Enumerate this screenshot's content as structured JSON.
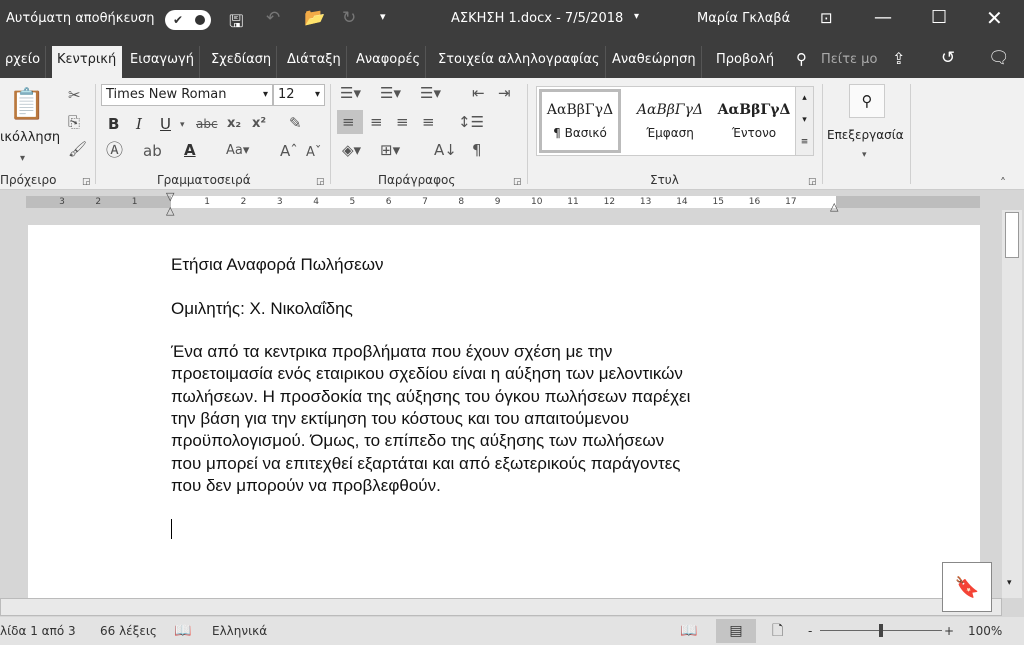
{
  "titlebar": {
    "autosave_label": "Αυτόματη αποθήκευση",
    "doc_title": "ΑΣΚΗΣΗ 1.docx  -  7/5/2018",
    "user": "Μαρία Γκλαβά"
  },
  "tabs": [
    {
      "label": "ρχείο"
    },
    {
      "label": "Κεντρική",
      "active": true
    },
    {
      "label": "Εισαγωγή"
    },
    {
      "label": "Σχεδίαση"
    },
    {
      "label": "Διάταξη"
    },
    {
      "label": "Αναφορές"
    },
    {
      "label": "Στοιχεία αλληλογραφίας"
    },
    {
      "label": "Αναθεώρηση"
    },
    {
      "label": "Προβολή"
    }
  ],
  "tell_me": "Πείτε μο",
  "ribbon": {
    "paste_label": "ικόλληση",
    "font_name": "Times New Roman",
    "font_size": "12",
    "groups": {
      "clipboard": "Πρόχειρο",
      "font": "Γραμματοσειρά",
      "paragraph": "Παράγραφος",
      "styles": "Στυλ"
    },
    "styles": [
      {
        "sample": "ΑαΒβΓγΔ",
        "label": "¶ Βασικό"
      },
      {
        "sample": "ΑαΒβΓγΔ",
        "label": "Έμφαση"
      },
      {
        "sample": "ΑαΒβΓγΔ",
        "label": "Έντονο"
      }
    ],
    "editing_label": "Επεξεργασία"
  },
  "ruler": {
    "left_numbers": [
      "3",
      "2",
      "1"
    ],
    "right_numbers": [
      "1",
      "2",
      "3",
      "4",
      "5",
      "6",
      "7",
      "8",
      "9",
      "10",
      "11",
      "12",
      "13",
      "14",
      "15",
      "16",
      "17"
    ]
  },
  "document": {
    "title": "Ετήσια Αναφορά Πωλήσεων",
    "speaker": "Ομιλητής: Χ. Νικολαΐδης",
    "paragraph_lines": [
      "Ένα από τα κεντρικα προβλήματα που έχουν σχέση με την",
      "προετοιμασία ενός εταιρικου σχεδίου είναι η αύξηση των μελοντικών",
      "πωλήσεων. Η προσδοκία της αύξησης του όγκου πωλήσεων παρέχει",
      "την βάση για την εκτίμηση του κόστους και του απαιτούμενου",
      "προϋπολογισμού.  Όμως, το επίπεδο της αύξησης των πωλήσεων",
      "που μπορεί να επιτεχθεί εξαρτάται και από εξωτερικούς παράγοντες",
      "που δεν μπορούν να προβλεφθούν."
    ]
  },
  "status": {
    "page": "λίδα 1 από 3",
    "words": "66 λέξεις",
    "language": "Ελληνικά",
    "zoom": "100%",
    "zoom_percent": 100
  }
}
